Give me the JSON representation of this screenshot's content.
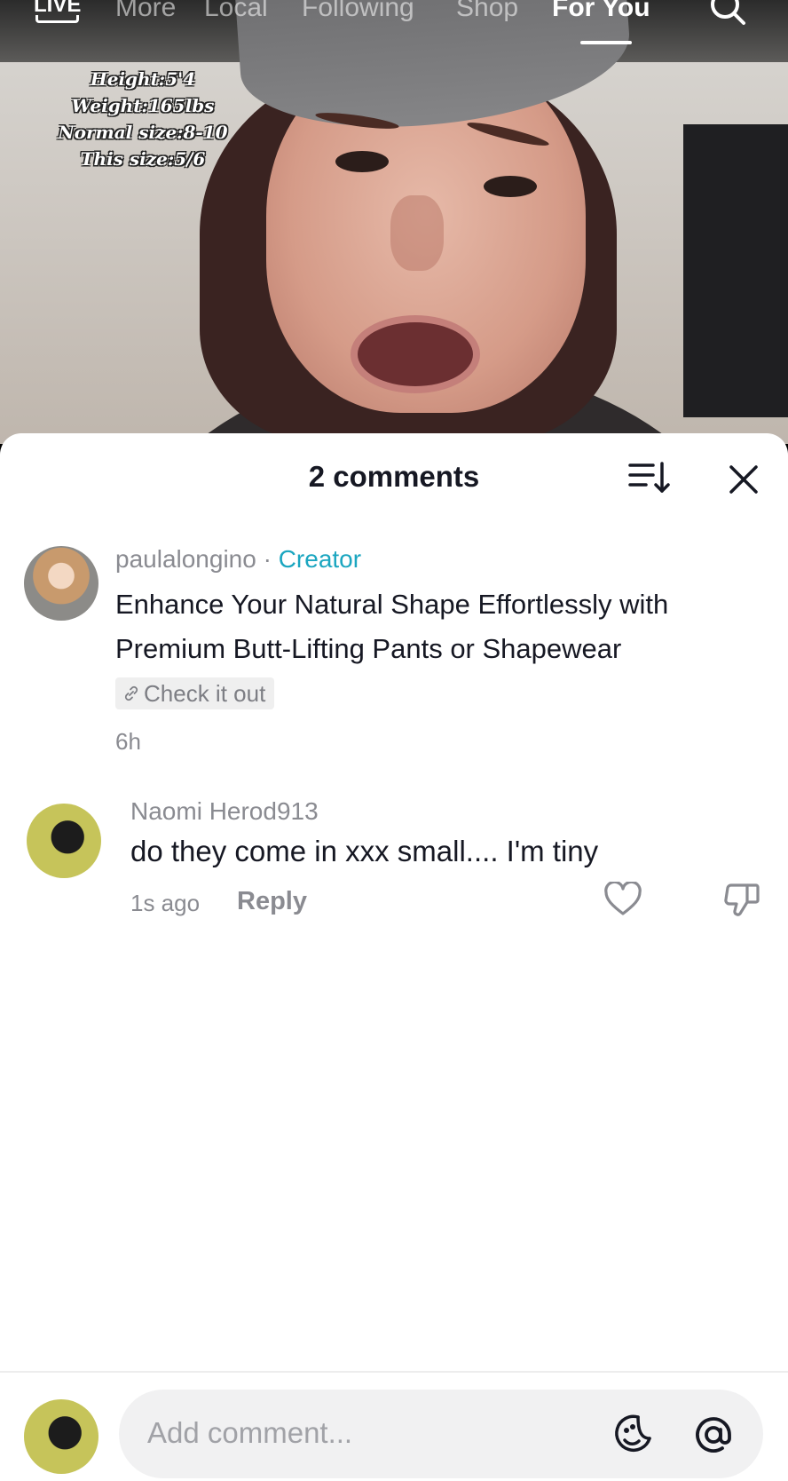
{
  "topnav": {
    "live": "LIVE",
    "tabs": [
      "More",
      "Local",
      "Following",
      "Shop",
      "For You"
    ],
    "active_tab": "For You"
  },
  "video_overlay": {
    "lines": [
      "Height:5'4",
      "Weight:165lbs",
      "Normal size:8-10",
      "This size:5/6"
    ]
  },
  "comments_sheet": {
    "title": "2 comments",
    "comments": [
      {
        "username": "paulalongino",
        "separator": "·",
        "badge": "Creator",
        "text": "Enhance Your Natural Shape Effortlessly with Premium Butt-Lifting Pants or Shapewear",
        "link_label": "Check it out",
        "time": "6h"
      },
      {
        "username": "Naomi Herod913",
        "text": "do they come in xxx small.... I'm tiny",
        "time": "1s ago",
        "reply_label": "Reply"
      }
    ]
  },
  "composer": {
    "placeholder": "Add comment..."
  },
  "colors": {
    "creator_badge": "#1ba6c0",
    "primary_text": "#161823",
    "secondary_text": "#8a8b91",
    "input_bg": "#f1f1f2"
  },
  "icons": [
    "search-icon",
    "sort-icon",
    "close-icon",
    "link-icon",
    "heart-icon",
    "dislike-icon",
    "emoji-icon",
    "at-icon"
  ]
}
